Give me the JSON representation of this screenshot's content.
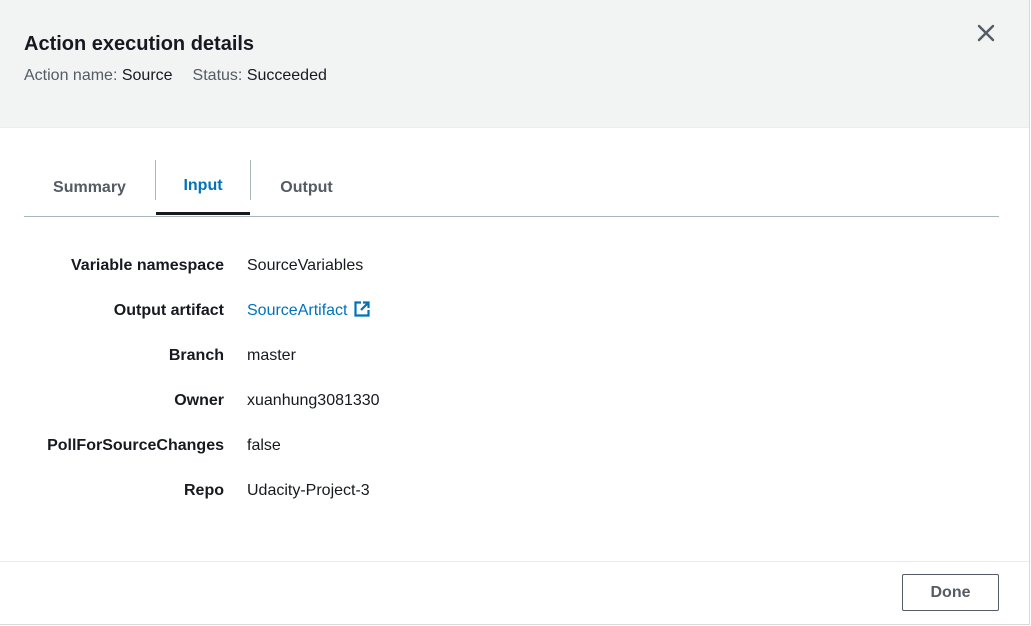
{
  "modal": {
    "title": "Action execution details",
    "action_name_label": "Action name:",
    "action_name_value": "Source",
    "status_label": "Status:",
    "status_value": "Succeeded",
    "close_icon": "close-icon"
  },
  "tabs": [
    {
      "label": "Summary",
      "active": false
    },
    {
      "label": "Input",
      "active": true
    },
    {
      "label": "Output",
      "active": false
    }
  ],
  "details": [
    {
      "key": "Variable namespace",
      "value": "SourceVariables"
    },
    {
      "key": "Output artifact",
      "value": "SourceArtifact",
      "link": true,
      "icon": "external-link-icon"
    },
    {
      "key": "Branch",
      "value": "master"
    },
    {
      "key": "Owner",
      "value": "xuanhung3081330"
    },
    {
      "key": "PollForSourceChanges",
      "value": "false"
    },
    {
      "key": "Repo",
      "value": "Udacity-Project-3"
    }
  ],
  "footer": {
    "done_label": "Done"
  },
  "colors": {
    "header_bg": "#f2f3f3",
    "link": "#0073bb",
    "text": "#16191f",
    "muted": "#545b64"
  }
}
